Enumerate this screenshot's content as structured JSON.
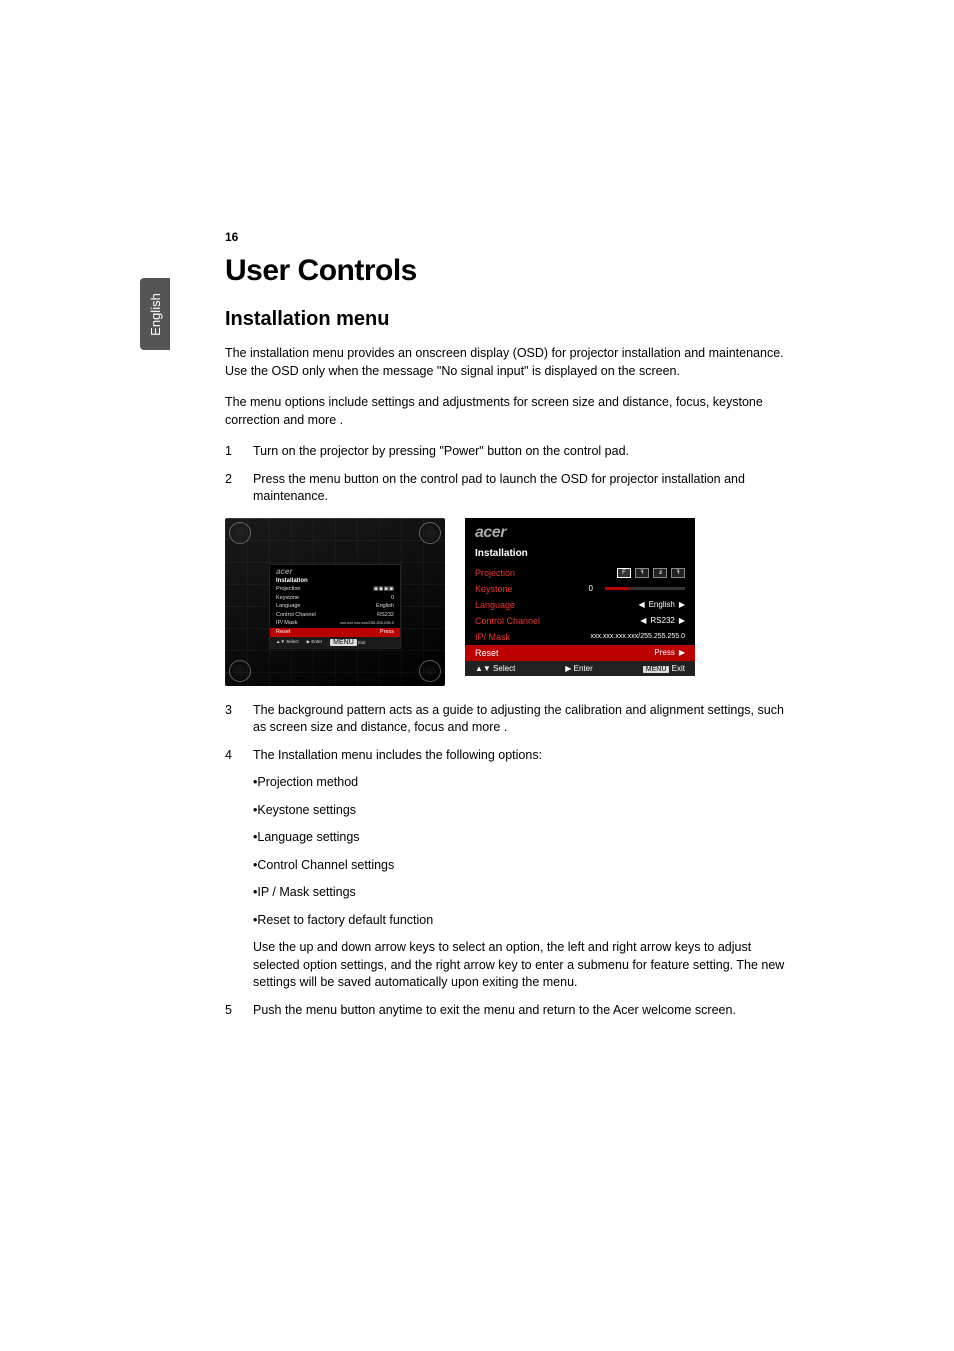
{
  "page_number": "16",
  "side_tab": "English",
  "h1": "User Controls",
  "h2": "Installation menu",
  "intro1": "The installation menu provides an onscreen display (OSD) for projector installation and maintenance. Use the OSD only when the message \"No signal input\" is displayed on the screen.",
  "intro2": "The menu options include settings and adjustments for screen size and distance, focus, keystone correction and more .",
  "steps": {
    "s1": "Turn on the projector by pressing \"Power\" button on the control pad.",
    "s2": "Press the menu button on the control pad to launch the OSD for projector installation and maintenance.",
    "s3": "The background pattern acts as a guide to adjusting the calibration and alignment settings, such as screen size and distance, focus and more .",
    "s4_lead": "The Installation menu includes the following options:",
    "s4_bullets": [
      "•Projection method",
      "•Keystone settings",
      "•Language settings",
      "•Control Channel settings",
      "•IP / Mask settings",
      "•Reset to factory default function"
    ],
    "s4_tail": "Use the up and down arrow keys to select an option, the left and right arrow keys to adjust selected option settings, and the right arrow key to enter a submenu for feature setting. The new settings will be saved automatically upon exiting the menu.",
    "s5": "Push the menu button anytime to exit the menu and return to the Acer welcome screen."
  },
  "osd": {
    "brand": "acer",
    "title": "Installation",
    "rows": [
      {
        "label": "Projection",
        "value": ""
      },
      {
        "label": "Keystone",
        "value": "0"
      },
      {
        "label": "Language",
        "value": "English"
      },
      {
        "label": "Control Channel",
        "value": "RS232"
      },
      {
        "label": "IP/ Mask",
        "value": "xxx.xxx.xxx.xxx/255.255.255.0"
      },
      {
        "label": "Reset",
        "value": "Press",
        "selected": true
      }
    ],
    "footer": {
      "select": "▲▼ Select",
      "enter": "▶ Enter",
      "exit": "Exit",
      "menu_badge": "MENU"
    }
  }
}
